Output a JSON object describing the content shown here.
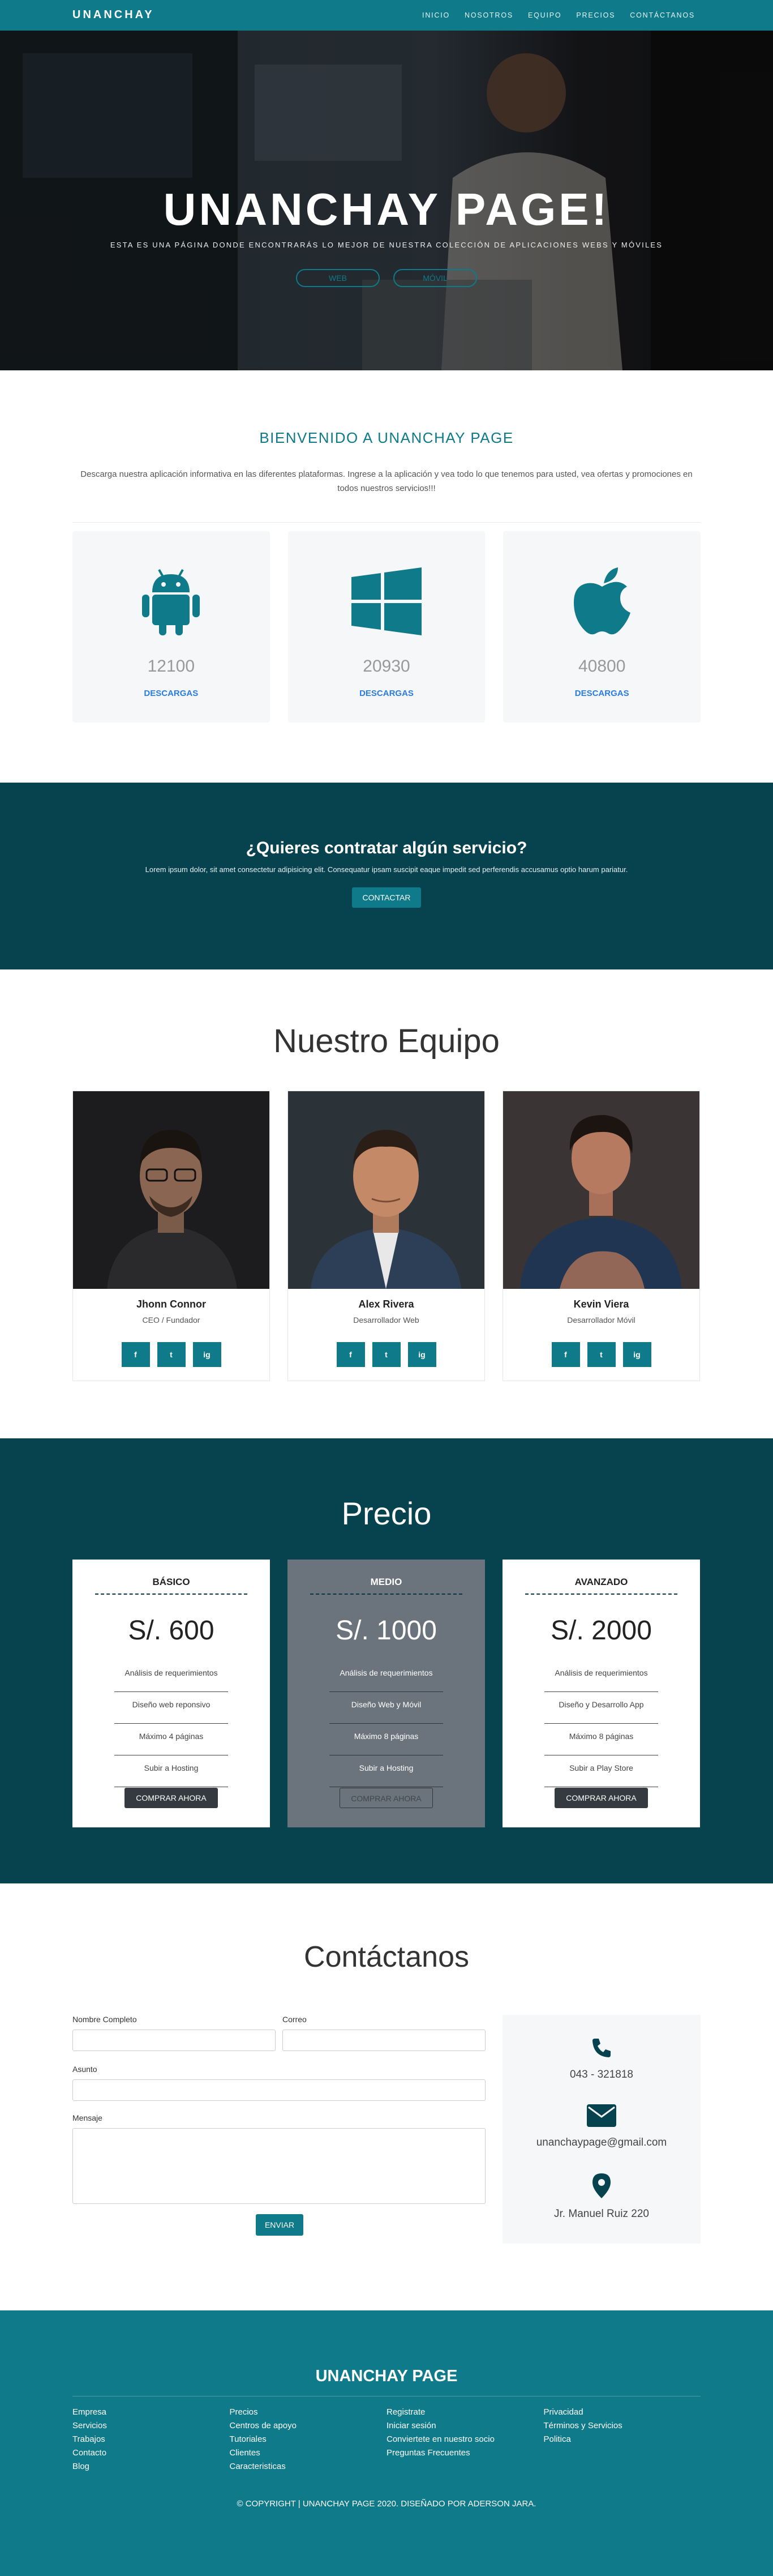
{
  "nav": {
    "brand": "UNANCHAY",
    "links": [
      "INICIO",
      "NOSOTROS",
      "EQUIPO",
      "PRECIOS",
      "CONTÁCTANOS"
    ]
  },
  "hero": {
    "title": "UNANCHAY PAGE!",
    "subtitle": "ESTA ES UNA PÁGINA DONDE ENCONTRARÁS LO MEJOR DE NUESTRA COLECCIÓN DE APLICACIONES WEBS Y MÓVILES",
    "btn_web": "WEB",
    "btn_movil": "MÓVIL"
  },
  "welcome": {
    "title": "BIENVENIDO A UNANCHAY PAGE",
    "text": "Descarga nuestra aplicación informativa en las diferentes plataformas. Ingrese a la aplicación y vea todo lo que tenemos para usted, vea ofertas y promociones en todos nuestros servicios!!!",
    "cards": [
      {
        "icon": "android-icon",
        "count": "12100",
        "label": "DESCARGAS"
      },
      {
        "icon": "windows-icon",
        "count": "20930",
        "label": "DESCARGAS"
      },
      {
        "icon": "apple-icon",
        "count": "40800",
        "label": "DESCARGAS"
      }
    ]
  },
  "cta": {
    "title": "¿Quieres contratar algún servicio?",
    "text": "Lorem ipsum dolor, sit amet consectetur adipisicing elit. Consequatur ipsam suscipit eaque impedit sed perferendis accusamus optio harum pariatur.",
    "button": "CONTACTAR"
  },
  "team": {
    "title": "Nuestro Equipo",
    "members": [
      {
        "name": "Jhonn Connor",
        "role": "CEO / Fundador"
      },
      {
        "name": "Alex Rivera",
        "role": "Desarrollador Web"
      },
      {
        "name": "Kevin Viera",
        "role": "Desarrollador Móvil"
      }
    ],
    "social": [
      "f",
      "t",
      "ig"
    ]
  },
  "pricing": {
    "title": "Precio",
    "plans": [
      {
        "name": "BÁSICO",
        "price": "S/. 600",
        "features": [
          "Análisis de requerimientos",
          "Diseño web reponsivo",
          "Máximo 4 páginas",
          "Subir a Hosting"
        ],
        "button": "COMPRAR AHORA"
      },
      {
        "name": "MEDIO",
        "price": "S/. 1000",
        "features": [
          "Análisis de requerimientos",
          "Diseño Web y Móvil",
          "Máximo 8 páginas",
          "Subir a Hosting"
        ],
        "button": "COMPRAR AHORA"
      },
      {
        "name": "AVANZADO",
        "price": "S/. 2000",
        "features": [
          "Análisis de requerimientos",
          "Diseño y Desarrollo App",
          "Máximo 8 páginas",
          "Subir a Play Store"
        ],
        "button": "COMPRAR AHORA"
      }
    ]
  },
  "contact": {
    "title": "Contáctanos",
    "labels": {
      "name": "Nombre Completo",
      "email": "Correo",
      "subject": "Asunto",
      "message": "Mensaje"
    },
    "send": "ENVIAR",
    "phone": "043 - 321818",
    "email": "unanchaypage@gmail.com",
    "address": "Jr. Manuel Ruiz 220"
  },
  "footer": {
    "title": "UNANCHAY PAGE",
    "cols": [
      [
        "Empresa",
        "Servicios",
        "Trabajos",
        "Contacto",
        "Blog"
      ],
      [
        "Precios",
        "Centros de apoyo",
        "Tutoriales",
        "Clientes",
        "Caracteristicas"
      ],
      [
        "Registrate",
        "Iniciar sesión",
        "Conviertete en nuestro socio",
        "Preguntas Frecuentes"
      ],
      [
        "Privacidad",
        "Términos y Servicios",
        "Politica"
      ]
    ],
    "copyright": "© COPYRIGHT | UNANCHAY PAGE 2020. DISEÑADO POR ADERSON JARA."
  },
  "colors": {
    "accent": "#0e7a8a",
    "dark": "#06434f",
    "link": "#2a7be4"
  }
}
